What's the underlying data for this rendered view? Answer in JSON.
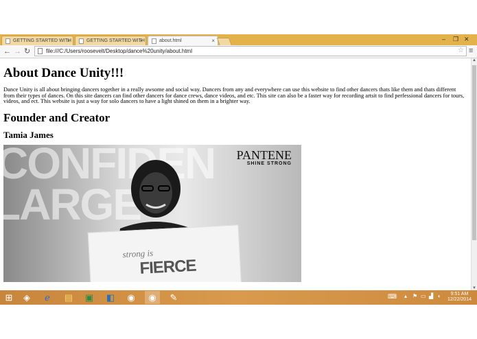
{
  "browser": {
    "tabs": [
      {
        "label": "GETTING STARTED WITH"
      },
      {
        "label": "GETTING STARTED WITH"
      },
      {
        "label": "about.html"
      }
    ],
    "url": "file:///C:/Users/roosevelt/Desktop/dance%20unity/about.html"
  },
  "page": {
    "heading": "About Dance Unity!!!",
    "description": "Dance Unity is all about bringing dancers together in a really awsome and social way. Dancers from any and everywhere can use this website to find other dancers thats like them and thats different from their types of dances. On this site dancers can find other dancers for dance crews, dance videos, and etc. This site can also be a faster way for recording artsit to find perfessional dancers for tours, videos, and ect. This website is just a way for solo dancers to have a light shined on them in a brighter way.",
    "founder_heading": "Founder and Creator",
    "founder_name": "Tamia James",
    "photo": {
      "brand": "PANTENE",
      "brand_tagline": "SHINE STRONG",
      "background_words": [
        "CONFIDEN",
        "LARGE"
      ],
      "sign_small": "strong is",
      "sign_big": "FIERCE"
    }
  },
  "taskbar": {
    "apps": [
      "windows-icon",
      "unity-icon",
      "internet-explorer-icon",
      "file-explorer-icon",
      "excel-icon",
      "remote-desktop-icon",
      "chrome-icon",
      "chrome-icon",
      "paint-icon"
    ],
    "time": "9:51 AM",
    "date": "12/22/2014"
  }
}
